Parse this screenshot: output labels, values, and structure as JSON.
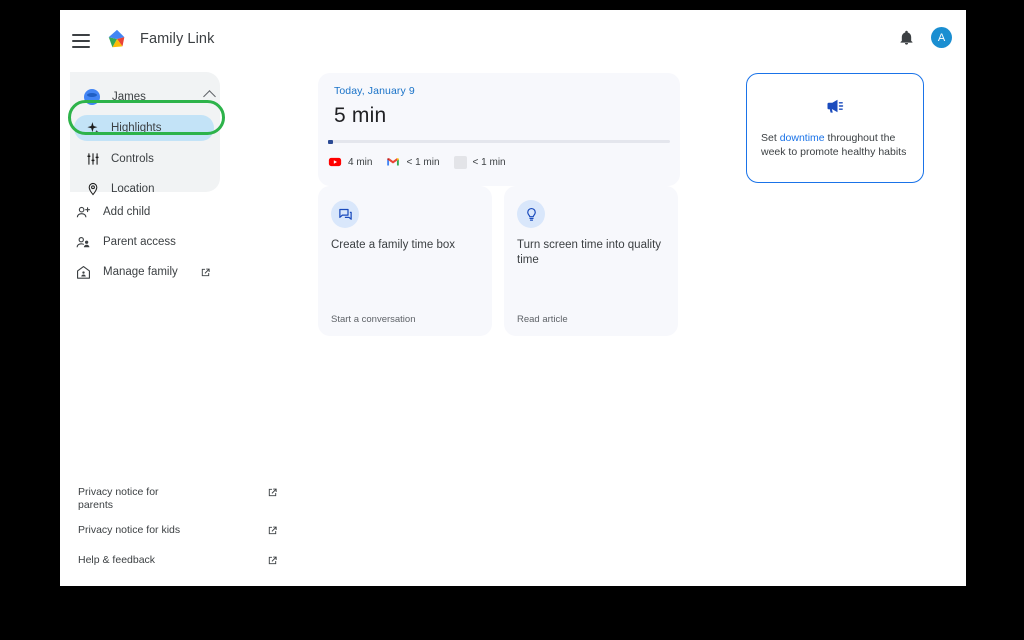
{
  "topbar": {
    "menu_icon": "hamburger-menu-icon",
    "logo_icon": "family-link-logo",
    "title": "Family Link",
    "notification_icon": "bell-icon",
    "avatar_letter": "A",
    "avatar_color": "#1a8ed1"
  },
  "sidebar": {
    "child": {
      "name": "James",
      "avatar_icon": "child-avatar",
      "expand_icon": "chevron-up-icon"
    },
    "nav_items": [
      {
        "label": "Highlights",
        "icon": "sparkle-icon",
        "selected": true
      },
      {
        "label": "Controls",
        "icon": "sliders-icon",
        "selected": false
      },
      {
        "label": "Location",
        "icon": "location-pin-icon",
        "selected": false
      }
    ],
    "links": [
      {
        "label": "Add child",
        "icon": "person-add-icon",
        "external": false
      },
      {
        "label": "Parent access",
        "icon": "people-icon",
        "external": false
      },
      {
        "label": "Manage family",
        "icon": "home-family-icon",
        "external": true
      }
    ],
    "footer_links": [
      {
        "label": "Privacy notice for parents",
        "external": true
      },
      {
        "label": "Privacy notice for kids",
        "external": true
      },
      {
        "label": "Help & feedback",
        "external": true
      }
    ],
    "highlight_ring_color": "#2db34a"
  },
  "main": {
    "screen_time": {
      "date": "Today, January 9",
      "total": "5 min",
      "apps": [
        {
          "name": "YouTube",
          "icon": "youtube-icon",
          "time": "4 min"
        },
        {
          "name": "Gmail",
          "icon": "gmail-icon",
          "time": "< 1 min"
        },
        {
          "name": "Other app",
          "icon": "app-placeholder-icon",
          "time": "< 1 min"
        }
      ]
    },
    "promo_card": {
      "icon": "megaphone-icon",
      "text_before": "Set ",
      "link_text": "downtime",
      "text_after": " throughout the week to promote healthy habits",
      "accent_color": "#1a73e8"
    },
    "content_cards": [
      {
        "icon": "chat-bubble-icon",
        "title": "Create a family time box",
        "action": "Start a conversation"
      },
      {
        "icon": "lightbulb-icon",
        "title": "Turn screen time into quality time",
        "action": "Read article"
      }
    ]
  }
}
